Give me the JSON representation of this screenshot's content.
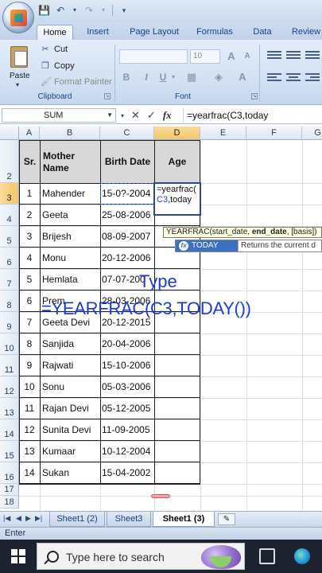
{
  "quick_access": {
    "icons": [
      "save-icon",
      "undo-icon",
      "redo-icon",
      "customize-icon"
    ],
    "symbols": [
      "💾",
      "↶",
      "▾",
      "↷",
      "▾",
      "▾"
    ]
  },
  "ribbon_tabs": [
    "Home",
    "Insert",
    "Page Layout",
    "Formulas",
    "Data",
    "Review"
  ],
  "clipboard": {
    "paste_label": "Paste",
    "cut_label": "Cut",
    "copy_label": "Copy",
    "format_painter_label": "Format Painter",
    "group_label": "Clipboard"
  },
  "font_group": {
    "size_value": "10",
    "group_label": "Font",
    "bold": "B",
    "italic": "I",
    "underline": "U",
    "grow": "A",
    "shrink": "A"
  },
  "formula_bar": {
    "name_box": "SUM",
    "cancel": "✕",
    "enter": "✓",
    "fx": "fx",
    "formula": "=yearfrac(C3,today"
  },
  "columns": [
    "A",
    "B",
    "C",
    "D",
    "E",
    "F",
    "G"
  ],
  "rows": [
    "2",
    "3",
    "4",
    "5",
    "6",
    "7",
    "8",
    "9",
    "10",
    "11",
    "12",
    "13",
    "14",
    "15",
    "16",
    "17",
    "18"
  ],
  "table": {
    "headers": {
      "sr": "Sr.",
      "mother_name": "Mother Name",
      "birth_date": "Birth Date",
      "age": "Age"
    },
    "rows": [
      {
        "sr": "1",
        "name": "Mahender",
        "date": "15-0?-2004"
      },
      {
        "sr": "2",
        "name": "Geeta",
        "date": "25-08-2006"
      },
      {
        "sr": "3",
        "name": "Brijesh",
        "date": "08-09-2007"
      },
      {
        "sr": "4",
        "name": "Monu",
        "date": "20-12-2006"
      },
      {
        "sr": "5",
        "name": "Hemlata",
        "date": "07-07-200"
      },
      {
        "sr": "6",
        "name": "Prem",
        "date": "28-03-2006"
      },
      {
        "sr": "7",
        "name": "Geeta Devi",
        "date": "20-12-2015"
      },
      {
        "sr": "8",
        "name": "Sanjida",
        "date": "20-04-2006"
      },
      {
        "sr": "9",
        "name": "Rajwati",
        "date": "15-10-2006"
      },
      {
        "sr": "10",
        "name": "Sonu",
        "date": "05-03-2006"
      },
      {
        "sr": "11",
        "name": "Rajan Devi",
        "date": "05-12-2005"
      },
      {
        "sr": "12",
        "name": "Sunita Devi",
        "date": "11-09-2005"
      },
      {
        "sr": "13",
        "name": "Kumaar",
        "date": "10-12-2004"
      },
      {
        "sr": "14",
        "name": "Sukan",
        "date": "15-04-2002"
      }
    ]
  },
  "edit_cell": {
    "line1": "=yearfrac(",
    "line2_ref": "C3",
    "line2_rest": ",today"
  },
  "tooltip": {
    "prefix": "YEARFRAC(start_date, ",
    "bold": "end_date",
    "suffix": ", [basis])"
  },
  "autocomplete": {
    "item": "TODAY",
    "description": "Returns the current d"
  },
  "overlay": {
    "type_word": "Type",
    "formula": "=YEARFRAC(C3,TODAY())"
  },
  "sheet_tabs": [
    "Sheet1 (2)",
    "Sheet3",
    "Sheet1 (3)"
  ],
  "status": "Enter",
  "taskbar": {
    "search_placeholder": "Type here to search"
  }
}
